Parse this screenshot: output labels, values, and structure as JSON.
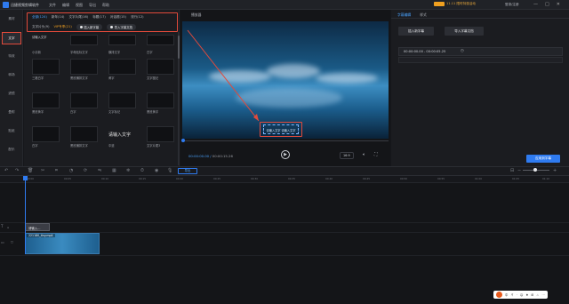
{
  "app": {
    "title": "迅捷视频剪辑软件",
    "menu": [
      "文件",
      "编辑",
      "视图",
      "导出",
      "帮助"
    ],
    "promo_text": "11.11 限时特惠活动",
    "user": "登录/注册",
    "window_controls": [
      "—",
      "□",
      "✕"
    ]
  },
  "sidebar": {
    "items": [
      {
        "label": "素材"
      },
      {
        "label": "文字"
      },
      {
        "label": "特效"
      },
      {
        "label": "转场"
      },
      {
        "label": "滤镜"
      },
      {
        "label": "叠附"
      },
      {
        "label": "贴纸"
      },
      {
        "label": "配乐"
      }
    ],
    "active": "文字"
  },
  "text_panel": {
    "tabs_row1": [
      "全部(124)",
      "新年(14)",
      "文字片尾(16)",
      "标题(17)",
      "对话框(15)",
      "流行(12)"
    ],
    "tabs_row2": [
      "文字片头(9)",
      "VIP专享(21)"
    ],
    "add_subtitle_btn": "插入新字幕",
    "import_subtitle_btn": "导入字幕文档",
    "first_label": "请输入文字",
    "tiles": [
      {
        "label": "小清新",
        "top": "请输入文字"
      },
      {
        "label": "字母贴标文字"
      },
      {
        "label": "横排文字"
      },
      {
        "label": "白字"
      },
      {
        "label": "三格白字"
      },
      {
        "label": "黑底横排文字"
      },
      {
        "label": "黄字"
      },
      {
        "label": "文字图记"
      },
      {
        "label": "黑底黄字"
      },
      {
        "label": "白字"
      },
      {
        "label": "文字标记"
      },
      {
        "label": "黑底黄字"
      },
      {
        "label": "白字"
      },
      {
        "label": "黑底横排文字"
      },
      {
        "label": "中道",
        "big": "请输入文字"
      },
      {
        "label": "文字片尾3"
      }
    ]
  },
  "player": {
    "title": "播放器",
    "caption_text": "请输入文字 请输入文字",
    "current_time": "00:00:00.00",
    "total_time": "00:00:15.26",
    "ratio": "16:9"
  },
  "subtitle_panel": {
    "tabs": [
      "字幕编辑",
      "样式"
    ],
    "add_btn": "插入新字幕",
    "import_btn": "导入字幕文档",
    "time_range": "00:00:00.00 - 00:00:05.25",
    "apply_btn": "应用到字幕"
  },
  "toolbar": {
    "export_btn": "导出"
  },
  "timeline": {
    "ticks": [
      "00:00",
      "00:05",
      "00:10",
      "00:15",
      "00:20",
      "00:25",
      "00:30",
      "00:35",
      "00:40",
      "00:45",
      "00:50",
      "00:55",
      "01:00",
      "01:05",
      "01:10",
      "01:15"
    ],
    "subtitle_clip": "请输入...",
    "video_clip": "221180_tiny.mp4"
  },
  "ime": {
    "items": [
      "中",
      "ㄔ",
      "·",
      "☺",
      "♦",
      "⊞",
      "♨",
      "⋯"
    ]
  }
}
